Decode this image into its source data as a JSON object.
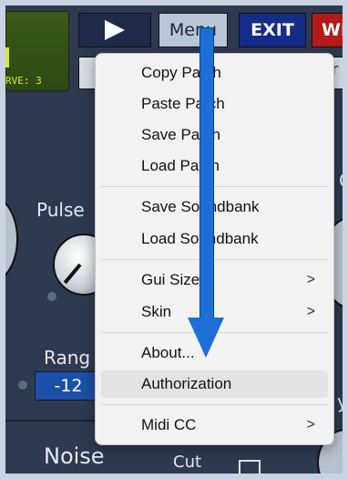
{
  "lcd": {
    "text": "RVE: 3"
  },
  "toolbar": {
    "menu_label": "Menu",
    "exit_label": "EXIT",
    "wr_label": "WR"
  },
  "patch": {
    "tail": "r"
  },
  "panel": {
    "pulse_label": "Pulse",
    "range_label": "Rang",
    "range_value": "-12",
    "noise_label": "Noise",
    "cut_label": "Cut",
    "right_c": "C",
    "right_y": "y"
  },
  "context_menu": {
    "items": [
      {
        "label": "Copy Patch"
      },
      {
        "label": "Paste Patch"
      },
      {
        "label": "Save Patch"
      },
      {
        "label": "Load Patch"
      },
      {
        "label": "Save Soundbank"
      },
      {
        "label": "Load Soundbank"
      },
      {
        "label": "Gui Size",
        "chevron": ">"
      },
      {
        "label": "Skin",
        "chevron": ">"
      },
      {
        "label": "About..."
      },
      {
        "label": "Authorization"
      },
      {
        "label": "Midi CC",
        "chevron": ">"
      }
    ],
    "hovered_item": "Authorization"
  },
  "colors": {
    "menu_bg": "#f2f2f2",
    "hover_bg": "#e3e3e3",
    "arrow": "#1b6fd6",
    "exit_btn": "#142c8a",
    "wr_btn": "#b51a1a",
    "range_box": "#1c4fa8"
  },
  "icons": [
    "play-icon",
    "chevron-right-icon",
    "down-arrow-annotation",
    "cut-icon"
  ]
}
